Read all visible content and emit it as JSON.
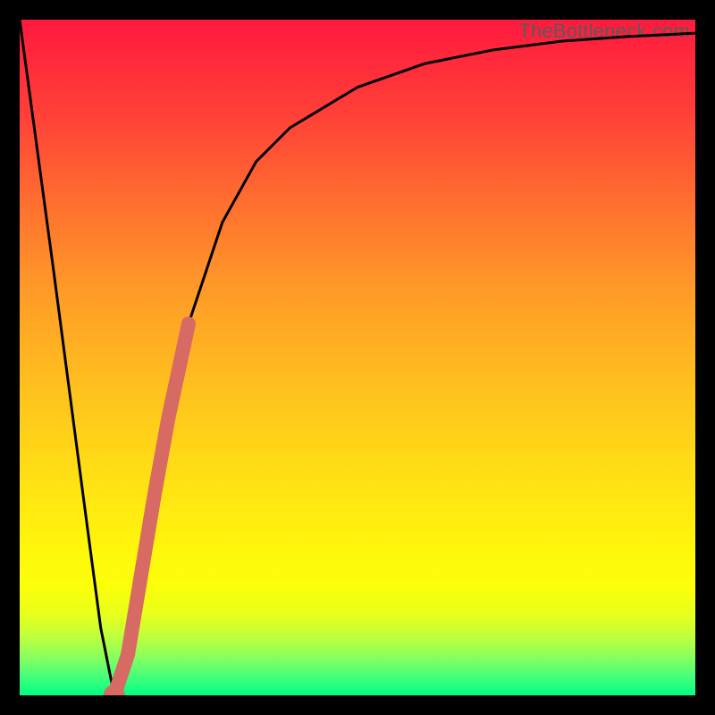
{
  "attribution": "TheBottleneck.com",
  "colors": {
    "frame": "#000000",
    "curve": "#000000",
    "highlight": "#d76a63",
    "gradient_top": "#ff1a3e",
    "gradient_bottom": "#00ff84"
  },
  "chart_data": {
    "type": "line",
    "title": "",
    "xlabel": "",
    "ylabel": "",
    "xlim": [
      0,
      100
    ],
    "ylim": [
      0,
      100
    ],
    "grid": false,
    "series": [
      {
        "name": "bottleneck-curve",
        "x": [
          0,
          5,
          10,
          12,
          14,
          16,
          18,
          20,
          22,
          25,
          30,
          35,
          40,
          50,
          60,
          70,
          80,
          90,
          100
        ],
        "y": [
          100,
          63,
          25,
          10,
          0,
          6,
          18,
          30,
          41,
          55,
          70,
          79,
          84,
          90,
          93.5,
          95.5,
          96.8,
          97.5,
          98
        ]
      }
    ],
    "highlight_segment": {
      "series": "bottleneck-curve",
      "x_range": [
        14,
        25
      ],
      "note": "thick salmon stroke along curve near minimum"
    },
    "annotations": [
      {
        "text": "TheBottleneck.com",
        "position": "top-right"
      }
    ]
  }
}
